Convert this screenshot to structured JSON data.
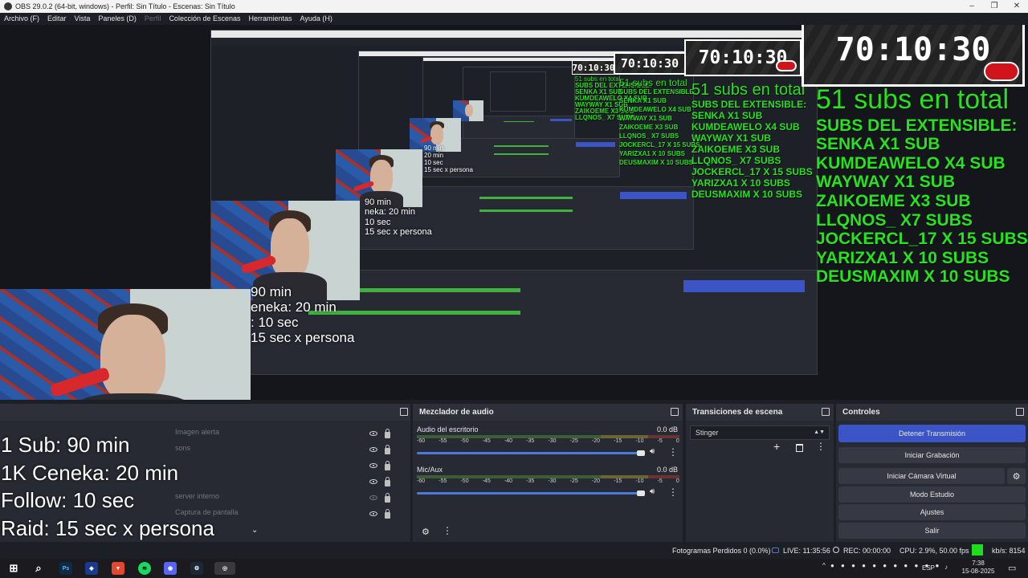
{
  "window": {
    "title": "OBS 29.0.2 (64-bit, windows) - Perfil: Sin Título - Escenas: Sin Título",
    "controls": [
      "–",
      "❐",
      "✕"
    ]
  },
  "menu": [
    {
      "label": "Archivo (F)",
      "enabled": true
    },
    {
      "label": "Editar",
      "enabled": true
    },
    {
      "label": "Vista",
      "enabled": true
    },
    {
      "label": "Paneles (D)",
      "enabled": true
    },
    {
      "label": "Perfil",
      "enabled": false
    },
    {
      "label": "Colección de Escenas",
      "enabled": true
    },
    {
      "label": "Herramientas",
      "enabled": true
    },
    {
      "label": "Ayuda (H)",
      "enabled": true
    }
  ],
  "overlay": {
    "timer": "70:10:30",
    "subs_total": "51 subs en total",
    "subs_header": "SUBS DEL EXTENSIBLE:",
    "subs_list": [
      "SENKA X1 SUB",
      "KUMDEAWELO X4 SUB",
      "WAYWAY X1 SUB",
      "ZAIKOEME X3 SUB",
      "LLQNOS_ X7 SUBS",
      "JOCKERCL_17 X 15 SUBS",
      "YARIZXA1 X 10 SUBS",
      "DEUSMAXIM X 10 SUBS"
    ],
    "cam_text": [
      "1 Sub: 90 min",
      "1K Ceneka: 20 min",
      "Follow: 10 sec",
      "Raid: 15 sec x persona"
    ],
    "cam_text_nested_1": [
      "90 min",
      "eneka: 20 min",
      ": 10 sec",
      "15 sec x persona"
    ],
    "cam_text_nested_2": [
      "90 min",
      "neka: 20 min",
      "10 sec",
      "15 sec x persona"
    ],
    "cam_text_nested_3": [
      "90 min",
      "20 min",
      "10 sec",
      "15 sec x persona"
    ],
    "brand_red": "#d1131c",
    "subs_green": "#25e41d"
  },
  "sources": {
    "rows": [
      {
        "name": "Imagen alerta",
        "visible": true
      },
      {
        "name": "sons",
        "visible": true
      },
      {
        "name": "",
        "visible": true
      },
      {
        "name": "",
        "visible": true
      },
      {
        "name": "server interno",
        "visible": false
      },
      {
        "name": "Captura de pantalla",
        "visible": true
      }
    ]
  },
  "mixer": {
    "title": "Mezclador de audio",
    "channels": [
      {
        "name": "Audio del escritorio",
        "db": "0.0 dB"
      },
      {
        "name": "Mic/Aux",
        "db": "0.0 dB"
      }
    ],
    "scale": [
      "-60",
      "-55",
      "-50",
      "-45",
      "-40",
      "-35",
      "-30",
      "-25",
      "-20",
      "-15",
      "-10",
      "-5",
      "0"
    ]
  },
  "transitions": {
    "title": "Transiciones de escena",
    "selected": "Stinger"
  },
  "controls": {
    "title": "Controles",
    "buttons": [
      "Detener Transmisión",
      "Iniciar Grabación",
      "Iniciar Cámara Virtual",
      "Modo Estudio",
      "Ajustes",
      "Salir"
    ],
    "accent": "#3b55c7"
  },
  "status": {
    "dropped": "Fotogramas Perdidos 0 (0.0%)",
    "live": "LIVE: 11:35:56",
    "rec": "REC: 00:00:00",
    "cpu": "CPU: 2.9%, 50.00 fps",
    "bitrate": "kb/s: 8154"
  },
  "taskbar": {
    "time": "7:38",
    "date": "15-08-2025",
    "lang": "ESP",
    "apps": [
      "windows-icon",
      "search-icon",
      "photoshop-icon",
      "app-icon",
      "brave-icon",
      "spotify-icon",
      "discord-icon",
      "steam-icon",
      "obs-icon"
    ],
    "photoshop_label": "Ps"
  }
}
